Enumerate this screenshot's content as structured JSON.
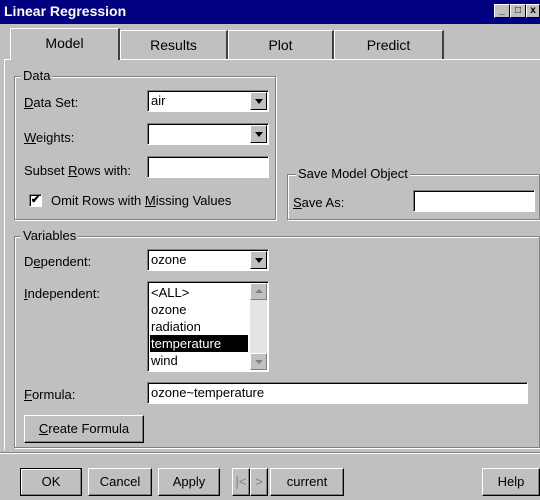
{
  "window": {
    "title": "Linear Regression",
    "controls": [
      "minimize-icon",
      "maximize-icon",
      "close-icon"
    ]
  },
  "tabs": [
    {
      "label": "Model",
      "active": true
    },
    {
      "label": "Results",
      "active": false
    },
    {
      "label": "Plot",
      "active": false
    },
    {
      "label": "Predict",
      "active": false
    }
  ],
  "data_group": {
    "legend": "Data",
    "dataset_label": "Data Set:",
    "dataset_value": "air",
    "weights_label": "Weights:",
    "weights_value": "",
    "subset_label": "Subset Rows with:",
    "subset_value": "",
    "omit_label": "Omit Rows with Missing Values",
    "omit_checked": true,
    "omit_check_glyph": "✔"
  },
  "save_group": {
    "legend": "Save Model Object",
    "save_as_label": "Save As:",
    "save_as_value": ""
  },
  "variables_group": {
    "legend": "Variables",
    "dependent_label": "Dependent:",
    "dependent_value": "ozone",
    "independent_label": "Independent:",
    "independent_items": [
      "<ALL>",
      "ozone",
      "radiation",
      "temperature",
      "wind"
    ],
    "independent_selected": "temperature",
    "formula_label": "Formula:",
    "formula_value": "ozone~temperature",
    "create_formula_label": "Create Formula"
  },
  "buttons": {
    "ok": "OK",
    "cancel": "Cancel",
    "apply": "Apply",
    "prev": "|<",
    "next": ">",
    "current": "current",
    "help": "Help"
  },
  "colors": {
    "titlebar": "#000080",
    "face": "#c0c0c0",
    "selection": "#000000"
  }
}
